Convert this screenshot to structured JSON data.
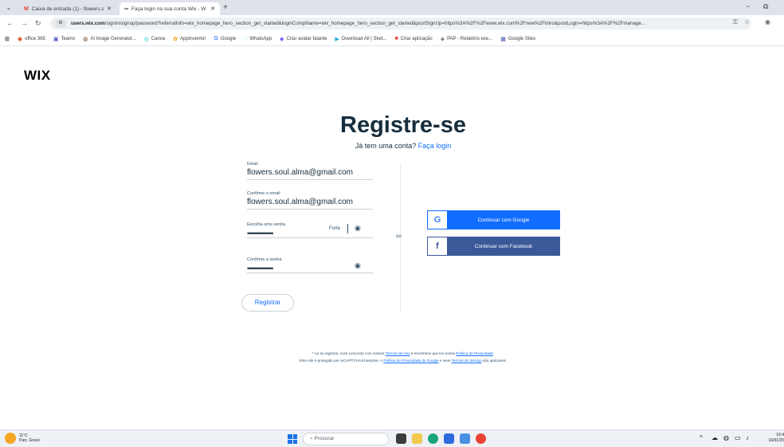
{
  "browser": {
    "tabs": [
      {
        "icon": "M",
        "title": "Caixa de entrada (1) - flowers.s",
        "close": "✕"
      },
      {
        "icon": "∞",
        "title": "Faça login na sua conta Wix - W",
        "close": "✕"
      }
    ],
    "new_tab": "+",
    "minimize": "−",
    "restore": "⧉",
    "url_host": "users.wix.com",
    "url_path": "/signin/signup/password?referralInfo=wix_homepage_hero_section_get_started&loginCompName=wix_homepage_hero_section_get_started&postSignUp=https%3A%2F%2Fwww.wix.com%2Fnew%2Fintro&postLogin=https%3A%2F%2Fmanage...",
    "bookmarks": [
      {
        "icon": "⊞",
        "label": ""
      },
      {
        "icon": "◉",
        "label": "office 365"
      },
      {
        "icon": "▣",
        "label": "Teams"
      },
      {
        "icon": "◍",
        "label": "AI Image Generator..."
      },
      {
        "icon": "◎",
        "label": "Canva"
      },
      {
        "icon": "✿",
        "label": "AppInventor"
      },
      {
        "icon": "G",
        "label": "Google"
      },
      {
        "icon": "◌",
        "label": "WhatsApp"
      },
      {
        "icon": "◆",
        "label": "Criar avatar falante"
      },
      {
        "icon": "▶",
        "label": "Download All | Sket..."
      },
      {
        "icon": "■",
        "label": "Criar aplicação"
      },
      {
        "icon": "◈",
        "label": "PAP - Relatório exe..."
      },
      {
        "icon": "▦",
        "label": "Google Sites"
      }
    ]
  },
  "page": {
    "logo": "WIX",
    "title": "Registre-se",
    "subtitle_text": "Já tem uma conta?",
    "subtitle_link": "Faça login",
    "email_label": "Email",
    "email_value": "flowers.soul.alma@gmail.com",
    "confirm_email_label": "Confirme o email",
    "confirm_email_value": "flowers.soul.alma@gmail.com",
    "password_label": "Escolha uma senha",
    "password_value": "•••••••••••••••",
    "password_strength": "Forte",
    "confirm_password_label": "Confirme a senha",
    "confirm_password_value": "•••••••••••••••",
    "register_button": "Registrar",
    "or_text": "ou",
    "google_icon": "G",
    "google_button": "Continuar com Google",
    "facebook_icon": "f",
    "facebook_button": "Continuar com Facebook",
    "terms_line1_a": "* Ao se registrar, você concorda com nossos ",
    "terms_line1_link1": "Termos de Uso",
    "terms_line1_b": " e reconhece que leu nossa ",
    "terms_line1_link2": "Política de Privacidade",
    "terms_line1_c": ".",
    "terms_line2_a": "Este site é protegido por reCAPTCHA Enterprise. A ",
    "terms_line2_link1": "Política de Privacidade do Google",
    "terms_line2_b": " e seus ",
    "terms_line2_link2": "Termos de Serviço",
    "terms_line2_c": " são aplicáveis."
  },
  "taskbar": {
    "temperature": "11°C",
    "weather": "Parc. Ensol",
    "search_placeholder": "Procurar",
    "time": "16:4",
    "date": "16/01/20"
  },
  "colors": {
    "accent": "#116dff",
    "facebook": "#3b5998",
    "heading": "#162d3d"
  }
}
